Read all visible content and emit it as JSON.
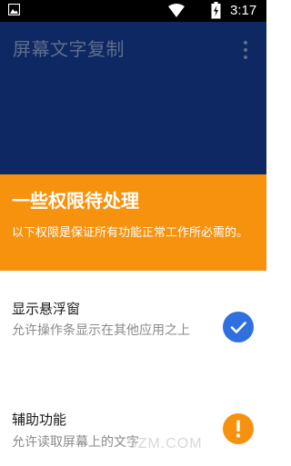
{
  "status_bar": {
    "time": "3:17",
    "icons": [
      "image-icon",
      "wifi-icon",
      "battery-icon"
    ]
  },
  "app_bar": {
    "title": "屏幕文字复制",
    "menu_icon": "more-vert-icon"
  },
  "banner": {
    "title": "一些权限待处理",
    "description": "以下权限是保证所有功能正常工作所必需的。"
  },
  "permissions": [
    {
      "title": "显示悬浮窗",
      "description": "允许操作条显示在其他应用之上",
      "status": "granted",
      "status_icon": "check-icon",
      "color": "#2f6fe0"
    },
    {
      "title": "辅助功能",
      "description": "允许读取屏幕上的文字",
      "status": "pending",
      "status_icon": "warning-icon",
      "color": "#f7920f"
    }
  ],
  "watermark": "SZM.COM",
  "colors": {
    "app_bar": "#0d2862",
    "banner": "#f7920f",
    "accent": "#2f6fe0"
  }
}
